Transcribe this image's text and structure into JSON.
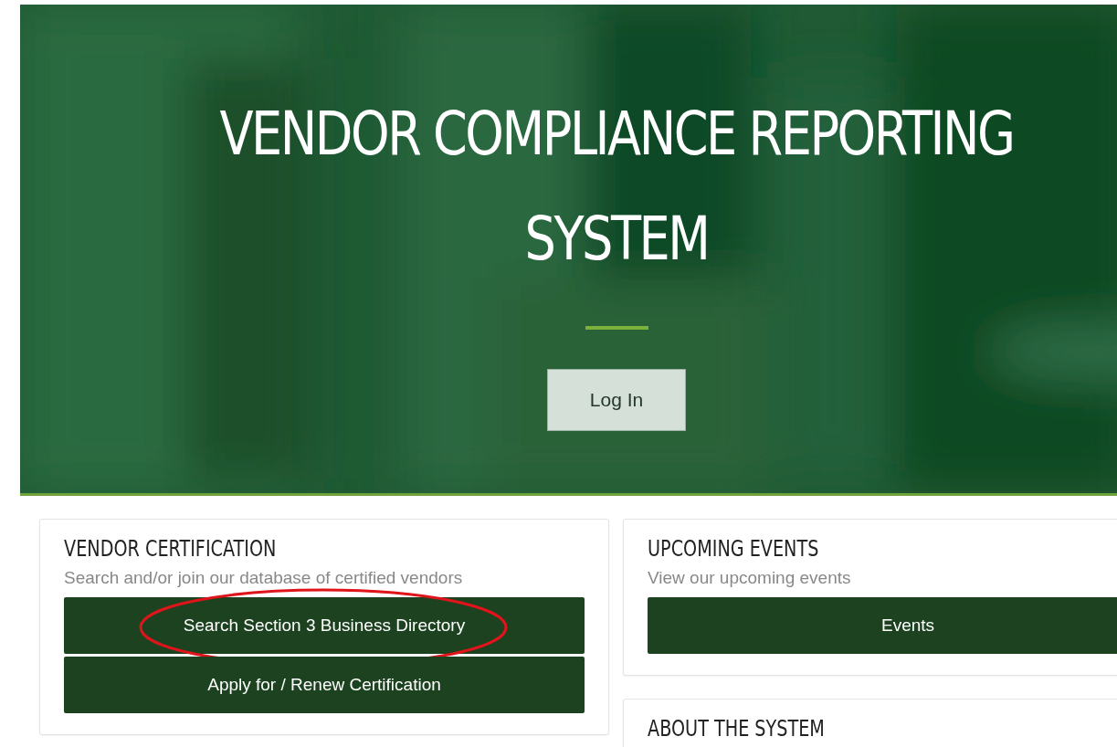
{
  "hero": {
    "title": "VENDOR COMPLIANCE REPORTING SYSTEM",
    "login_button": "Log In"
  },
  "cards": [
    {
      "title": "VENDOR CERTIFICATION",
      "subtitle": "Search and/or join our database of certified vendors",
      "buttons": [
        {
          "label": "Search Section 3 Business Directory",
          "highlighted": true
        },
        {
          "label": "Apply for / Renew Certification",
          "highlighted": false
        }
      ]
    },
    {
      "title": "UPCOMING EVENTS",
      "subtitle": "View our upcoming events",
      "buttons": [
        {
          "label": "Events",
          "highlighted": false
        }
      ]
    },
    {
      "title": "ABOUT THE SYSTEM"
    }
  ]
}
